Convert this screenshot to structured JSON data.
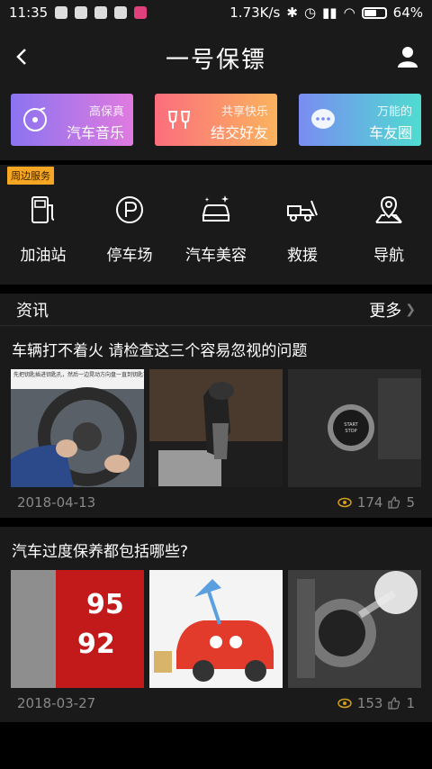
{
  "status_bar": {
    "time": "11:35",
    "speed": "1.73K/s",
    "battery": "64%",
    "battery_level": 0.64
  },
  "header": {
    "title": "一号保镖"
  },
  "banners": [
    {
      "top": "高保真",
      "main": "汽车音乐",
      "icon": "music-cd-icon"
    },
    {
      "top": "共享快乐",
      "main": "结交好友",
      "icon": "cheers-glasses-icon"
    },
    {
      "top": "万能的",
      "main": "车友圈",
      "icon": "chat-bubble-icon"
    }
  ],
  "services": {
    "tag": "周边服务",
    "items": [
      {
        "label": "加油站",
        "icon": "fuel-station-icon"
      },
      {
        "label": "停车场",
        "icon": "parking-icon"
      },
      {
        "label": "汽车美容",
        "icon": "car-wash-icon"
      },
      {
        "label": "救援",
        "icon": "tow-truck-icon"
      },
      {
        "label": "导航",
        "icon": "navigation-pin-icon"
      }
    ]
  },
  "news": {
    "title": "资讯",
    "more": "更多",
    "articles": [
      {
        "title": "车辆打不着火 请检查这三个容易忽视的问题",
        "date": "2018-04-13",
        "views": "174",
        "likes": "5",
        "thumb_caption": "先把钥匙插进钥匙孔，然后一边晃动方向盘一直到钥匙可以转动，方向盘锁就解开了。"
      },
      {
        "title": "汽车过度保养都包括哪些?",
        "date": "2018-03-27",
        "views": "153",
        "likes": "1",
        "pump_labels": [
          "95",
          "92"
        ]
      }
    ]
  },
  "colors": {
    "background": "#1a1a1a",
    "tag": "#f5a623",
    "view_icon": "#d4a017"
  }
}
